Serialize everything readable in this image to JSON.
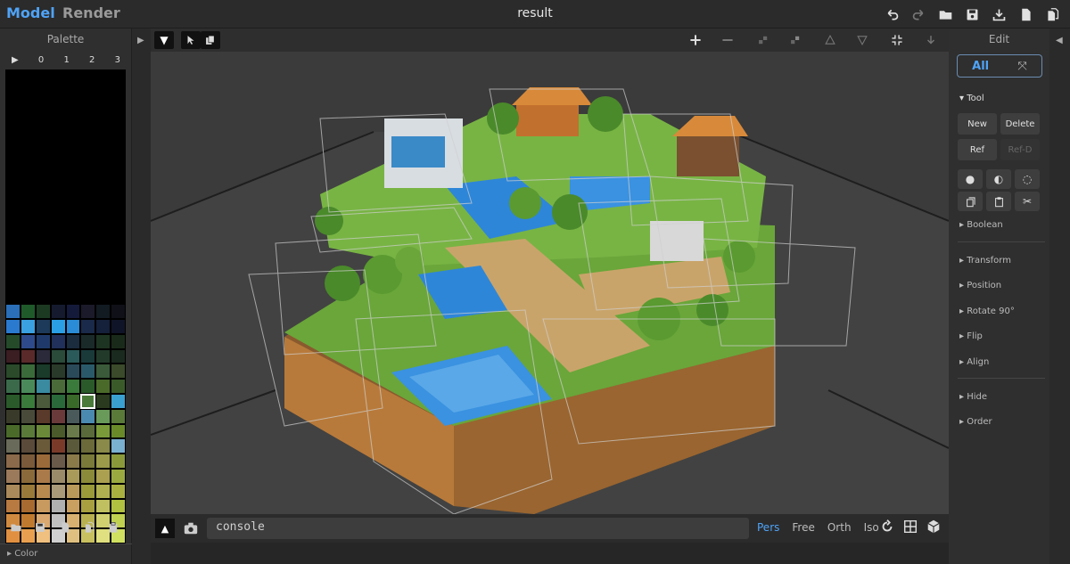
{
  "header": {
    "mode_model": "Model",
    "mode_render": "Render",
    "title": "result",
    "icons": [
      "undo-icon",
      "redo-icon",
      "open-folder-icon",
      "save-icon",
      "download-icon",
      "new-file-icon",
      "duplicate-icon"
    ]
  },
  "palette": {
    "title": "Palette",
    "tabs": [
      "▶",
      "0",
      "1",
      "2",
      "3"
    ],
    "swatches": [
      "#2a6fb8",
      "#1f5a2a",
      "#1c3a22",
      "#151a2e",
      "#141a3a",
      "#1a1a2a",
      "#121a22",
      "#0f1018",
      "#2a7ad0",
      "#3aa0e0",
      "#1e3a5a",
      "#2b9fe6",
      "#2a8cd6",
      "#1a2a4a",
      "#15203a",
      "#101428",
      "#244a2a",
      "#2e4a8a",
      "#1f3a6a",
      "#20305a",
      "#1a2c3e",
      "#1a2a28",
      "#1e3422",
      "#1a2a1a",
      "#3a1e22",
      "#5a2a2a",
      "#2a2a3a",
      "#2a4a3a",
      "#2a5a5a",
      "#1a3a3a",
      "#223a2a",
      "#1a2a1e",
      "#2a4a2a",
      "#3a6a3a",
      "#1a3a2a",
      "#2a3a2a",
      "#2a4a5a",
      "#2a5a6a",
      "#3a5a3a",
      "#3a4a2a",
      "#3a6a4a",
      "#4a8a5a",
      "#3a8aa0",
      "#4a6a3a",
      "#3a7a3a",
      "#2a5a2a",
      "#4a6a2a",
      "#3a5a2a",
      "#2a5a2a",
      "#3a7a3a",
      "#4a5a3a",
      "#2a6a3a",
      "#3a6a2a",
      "#4a7a3a",
      "#2a3a1e",
      "#3aa0d0",
      "#3a3a2a",
      "#4a4a3a",
      "#5a3a2a",
      "#6a3a3a",
      "#4a5a5a",
      "#4a8ab0",
      "#6a9a5a",
      "#5a7a3a",
      "#4a6a2a",
      "#5a7a3a",
      "#6a8a3a",
      "#4a5a2a",
      "#6a7a4a",
      "#5a6a3a",
      "#7a9a3a",
      "#6a8a2a",
      "#6a6a5a",
      "#5a4a3a",
      "#6a5a3a",
      "#7a3a2a",
      "#5a5a3a",
      "#6a6a3a",
      "#8a8a4a",
      "#7ab0d0",
      "#8a6a4a",
      "#7a5a3a",
      "#9a6a3a",
      "#6a5a4a",
      "#8a7a4a",
      "#7a7a3a",
      "#9a9a4a",
      "#8a9a3a",
      "#9a7a5a",
      "#8a6a3a",
      "#aa7a4a",
      "#9a8a6a",
      "#aa9a5a",
      "#8a8a3a",
      "#aaa050",
      "#9aaa40",
      "#aa8a5a",
      "#9a7a3a",
      "#b88a50",
      "#aa9a7a",
      "#ba9a5a",
      "#9a9a3a",
      "#b0b050",
      "#aab040",
      "#b87a40",
      "#a86a30",
      "#c89a60",
      "#b0b0b0",
      "#caa060",
      "#a8a040",
      "#c0c060",
      "#b0c040",
      "#d08a40",
      "#c07a30",
      "#d8a870",
      "#c0c0c0",
      "#d8b070",
      "#b8b050",
      "#d0d070",
      "#c0d050",
      "#e09040",
      "#e8a050",
      "#f0c080",
      "#d0d0d0",
      "#e0c080",
      "#c8c060",
      "#e0e080",
      "#d0e060"
    ],
    "selected_index": 53,
    "actions": [
      "folder-icon",
      "save-icon",
      "file-icon",
      "copy-icon",
      "clipboard-icon"
    ],
    "color_section": "Color"
  },
  "viewport": {
    "tools": [
      "collapse-icon",
      "select-icon",
      "multi-select-icon"
    ],
    "right_tools": [
      "zoom-in-icon",
      "zoom-out-icon",
      "stack-up-icon",
      "stack-down-icon",
      "triangle-up-icon",
      "triangle-down-icon",
      "compress-icon",
      "arrow-down-icon"
    ]
  },
  "bottom": {
    "console": "console",
    "modes": [
      "Pers",
      "Free",
      "Orth",
      "Iso"
    ],
    "active_mode": "Pers",
    "icons": [
      "rotate-icon",
      "grid-icon",
      "cube-icon"
    ]
  },
  "edit": {
    "title": "Edit",
    "all_label": "All",
    "tool_section": "Tool",
    "buttons": {
      "new": "New",
      "delete": "Delete",
      "ref": "Ref",
      "refd": "Ref-D"
    },
    "sections": [
      "Boolean",
      "Transform",
      "Position",
      "Rotate 90°",
      "Flip",
      "Align",
      "Hide",
      "Order"
    ]
  }
}
